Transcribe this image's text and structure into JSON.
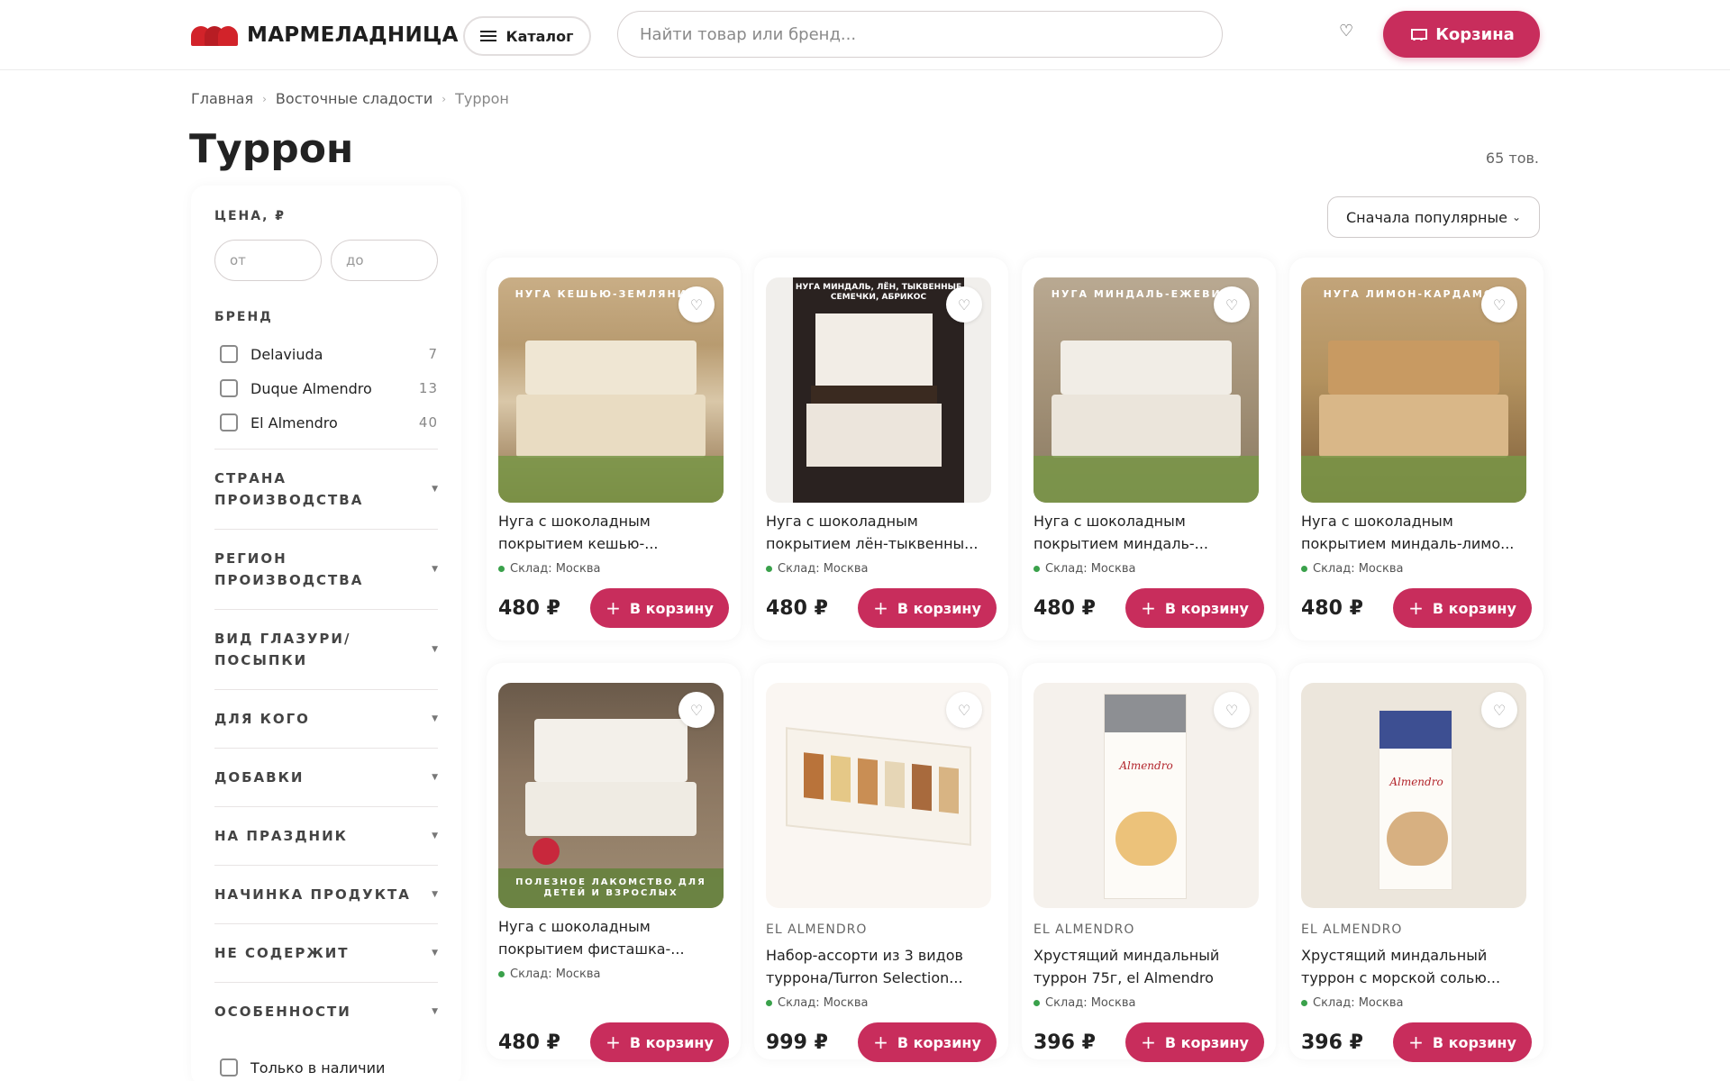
{
  "header": {
    "logo_text": "МАРМЕЛАДНИЦА",
    "catalog_label": "Каталог",
    "search_placeholder": "Найти товар или бренд...",
    "wishlist_icon": "♡",
    "cart_label": "Корзина"
  },
  "breadcrumb": {
    "items": [
      "Главная",
      "Восточные сладости",
      "Туррон"
    ],
    "separator": "›"
  },
  "page": {
    "title": "Туррон",
    "count": "65 тов.",
    "sort_value": "Сначала популярные",
    "sort_chevron": "⌄"
  },
  "filters": {
    "price_title": "ЦЕНА, ₽",
    "price_from_placeholder": "от",
    "price_to_placeholder": "до",
    "brand_title": "БРЕНД",
    "brands": [
      {
        "name": "Delaviuda",
        "count": "7"
      },
      {
        "name": "Duque Almendro",
        "count": "13"
      },
      {
        "name": "El Almendro",
        "count": "40"
      }
    ],
    "facets": [
      "СТРАНА ПРОИЗВОДСТВА",
      "РЕГИОН ПРОИЗВОДСТВА",
      "ВИД ГЛАЗУРИ/ПОСЫПКИ",
      "ДЛЯ КОГО",
      "ДОБАВКИ",
      "НА ПРАЗДНИК",
      "НАЧИНКА ПРОДУКТА",
      "НЕ СОДЕРЖИТ",
      "ОСОБЕННОСТИ"
    ],
    "facet_arrow": "▼",
    "in_stock_label": "Только в наличии"
  },
  "products": [
    {
      "brand": "",
      "title": "Нуга с шоколадным покрытием кешью-...",
      "stock": "Склад: Москва",
      "price": "480 ₽",
      "buy": "В корзину",
      "image_label": "НУГА КЕШЬЮ-ЗЕМЛЯНИКА"
    },
    {
      "brand": "",
      "title": "Нуга с шоколадным покрытием лён-тыквенны...",
      "stock": "Склад: Москва",
      "price": "480 ₽",
      "buy": "В корзину",
      "image_label": "НУГА МИНДАЛЬ, ЛЁН, ТЫКВЕННЫЕ СЕМЕЧКИ, АБРИКОС"
    },
    {
      "brand": "",
      "title": "Нуга с шоколадным покрытием миндаль-...",
      "stock": "Склад: Москва",
      "price": "480 ₽",
      "buy": "В корзину",
      "image_label": "НУГА МИНДАЛЬ-ЕЖЕВИКА"
    },
    {
      "brand": "",
      "title": "Нуга с шоколадным покрытием миндаль-лимо...",
      "stock": "Склад: Москва",
      "price": "480 ₽",
      "buy": "В корзину",
      "image_label": "НУГА ЛИМОН-КАРДАМОН"
    },
    {
      "brand": "",
      "title": "Нуга с шоколадным покрытием фисташка-...",
      "stock": "Склад: Москва",
      "price": "480 ₽",
      "buy": "В корзину",
      "image_label": "ПОЛЕЗНОЕ ЛАКОМСТВО ДЛЯ ДЕТЕЙ И ВЗРОСЛЫХ"
    },
    {
      "brand": "EL ALMENDRO",
      "title": "Набор-ассорти из 3 видов туррона/Turron Selection...",
      "stock": "Склад: Москва",
      "price": "999 ₽",
      "buy": "В корзину",
      "image_label": ""
    },
    {
      "brand": "EL ALMENDRO",
      "title": "Хрустящий миндальный туррон 75г, el Almendro",
      "stock": "Склад: Москва",
      "price": "396 ₽",
      "buy": "В корзину",
      "image_label": "Almendro"
    },
    {
      "brand": "EL ALMENDRO",
      "title": "Хрустящий миндальный туррон с морской солью...",
      "stock": "Склад: Москва",
      "price": "396 ₽",
      "buy": "В корзину",
      "image_label": "Almendro"
    }
  ],
  "colors": {
    "accent": "#c82d5c",
    "logo_red": "#d2232a",
    "stock_green": "#3aa14b"
  }
}
